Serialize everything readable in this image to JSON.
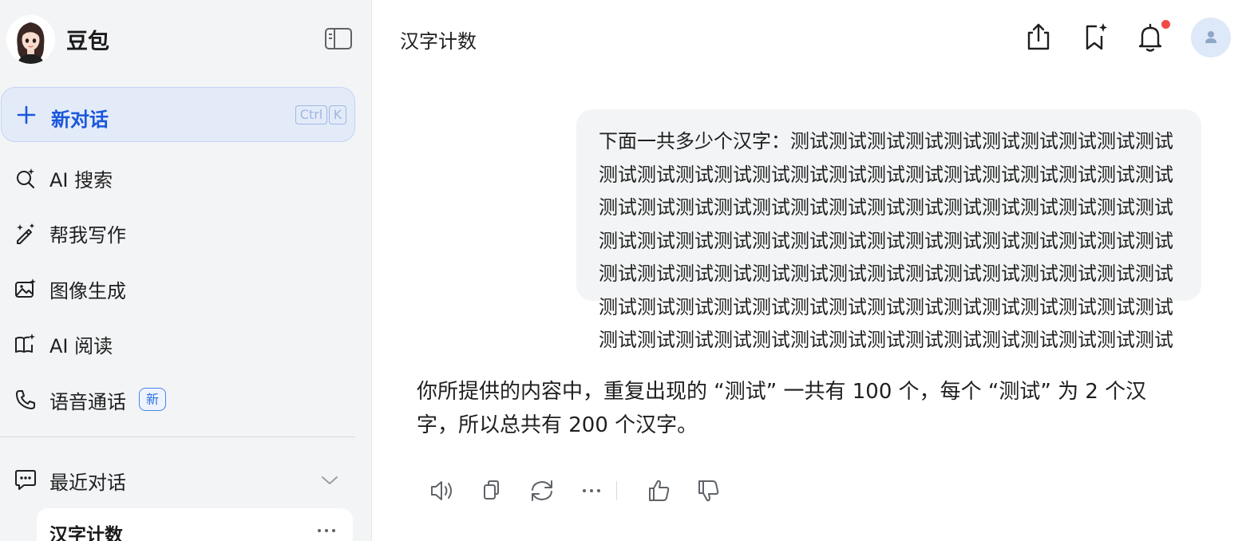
{
  "sidebar": {
    "brand_name": "豆包",
    "new_chat": {
      "label": "新对话",
      "shortcut_ctrl": "Ctrl",
      "shortcut_key": "K"
    },
    "items": [
      {
        "label": "AI 搜索",
        "icon": "ai-search-icon"
      },
      {
        "label": "帮我写作",
        "icon": "magic-pen-icon"
      },
      {
        "label": "图像生成",
        "icon": "image-spark-icon"
      },
      {
        "label": "AI 阅读",
        "icon": "book-spark-icon"
      },
      {
        "label": "语音通话",
        "icon": "phone-icon",
        "badge": "新"
      }
    ],
    "recent": {
      "label": "最近对话",
      "conversations": [
        {
          "title": "汉字计数"
        }
      ]
    }
  },
  "header": {
    "title": "汉字计数",
    "icons": [
      "share-icon",
      "bookmark-add-icon",
      "bell-icon",
      "user-avatar"
    ],
    "has_notification": true
  },
  "chat": {
    "user_message": "下面一共多少个汉字：测试测试测试测试测试测试测试测试测试测试测试测试测试测试测试测试测试测试测试测试测试测试测试测试测试测试测试测试测试测试测试测试测试测试测试测试测试测试测试测试测试测试测试测试测试测试测试测试测试测试测试测试测试测试测试测试测试测试测试测试测试测试测试测试测试测试测试测试测试测试测试测试测试测试测试测试测试测试测试测试测试测试测试测试测试测试测试测试测试测试测试测试测试测试测试测试测试测试测试测试",
    "assistant_message": "你所提供的内容中，重复出现的 “测试” 一共有 100 个，每个 “测试” 为 2 个汉字，所以总共有 200 个汉字。",
    "actions": [
      "speaker-icon",
      "copy-icon",
      "regenerate-icon",
      "more-icon",
      "thumbs-up-icon",
      "thumbs-down-icon"
    ]
  },
  "colors": {
    "accent": "#1a56db",
    "sidebar_bg": "#f3f4f6",
    "new_chat_bg": "#e3ebf9",
    "bubble_bg": "#f3f4f5",
    "notification": "#f04a45"
  }
}
